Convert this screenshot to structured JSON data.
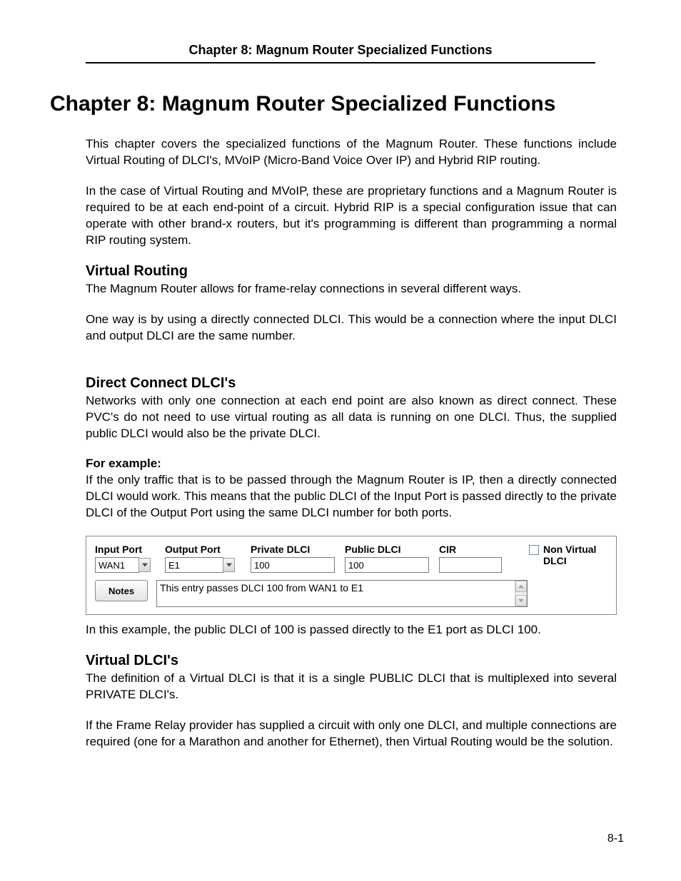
{
  "running_header": "Chapter 8: Magnum Router Specialized Functions",
  "chapter_title": "Chapter 8: Magnum Router Specialized Functions",
  "intro": {
    "p1": "This chapter covers the specialized functions of the Magnum Router.  These functions include Virtual Routing of DLCI's, MVoIP (Micro-Band Voice Over IP) and Hybrid RIP routing.",
    "p2": "In the case of Virtual Routing and MVoIP, these are proprietary functions and a Magnum Router is required to be at each end-point of a circuit.  Hybrid RIP is a special configuration issue that can operate with other brand-x routers, but it's programming is different than programming a normal RIP routing system."
  },
  "virtual_routing": {
    "heading": "Virtual Routing",
    "p1": "The Magnum Router allows for frame-relay connections in several different ways.",
    "p2": "One way is by using a directly connected DLCI.  This would be a connection where the input DLCI and output DLCI are the same number."
  },
  "direct_connect": {
    "heading": "Direct Connect DLCI's",
    "p1": "Networks with only one connection at each end point are also known as direct connect.  These PVC's do not need to use virtual routing as all data is running on one DLCI.  Thus, the supplied public DLCI would also be the private DLCI.",
    "example_label": "For example:",
    "p2": "If the only traffic that is to be passed through the Magnum Router is IP, then a directly connected DLCI would work.  This means that the public DLCI of the Input Port is passed directly to the private DLCI of the Output Port using the same DLCI number for both ports.",
    "caption": "In this example, the public DLCI of 100 is passed directly to the E1 port as DLCI 100."
  },
  "figure": {
    "labels": {
      "input_port": "Input Port",
      "output_port": "Output Port",
      "private_dlci": "Private DLCI",
      "public_dlci": "Public DLCI",
      "cir": "CIR",
      "non_virtual": "Non Virtual DLCI",
      "notes_btn": "Notes"
    },
    "values": {
      "input_port": "WAN1",
      "output_port": "E1",
      "private_dlci": "100",
      "public_dlci": "100",
      "cir": "",
      "notes": "This entry passes DLCI 100 from WAN1 to E1"
    }
  },
  "virtual_dlcis": {
    "heading": "Virtual DLCI's",
    "p1": "The definition of a Virtual DLCI is that it is a single PUBLIC DLCI that is multiplexed into several PRIVATE DLCI's.",
    "p2": "If the Frame Relay provider has supplied a circuit with only one DLCI, and multiple connections are required (one for a Marathon and another for Ethernet), then Virtual Routing would be the solution."
  },
  "page_number": "8-1"
}
